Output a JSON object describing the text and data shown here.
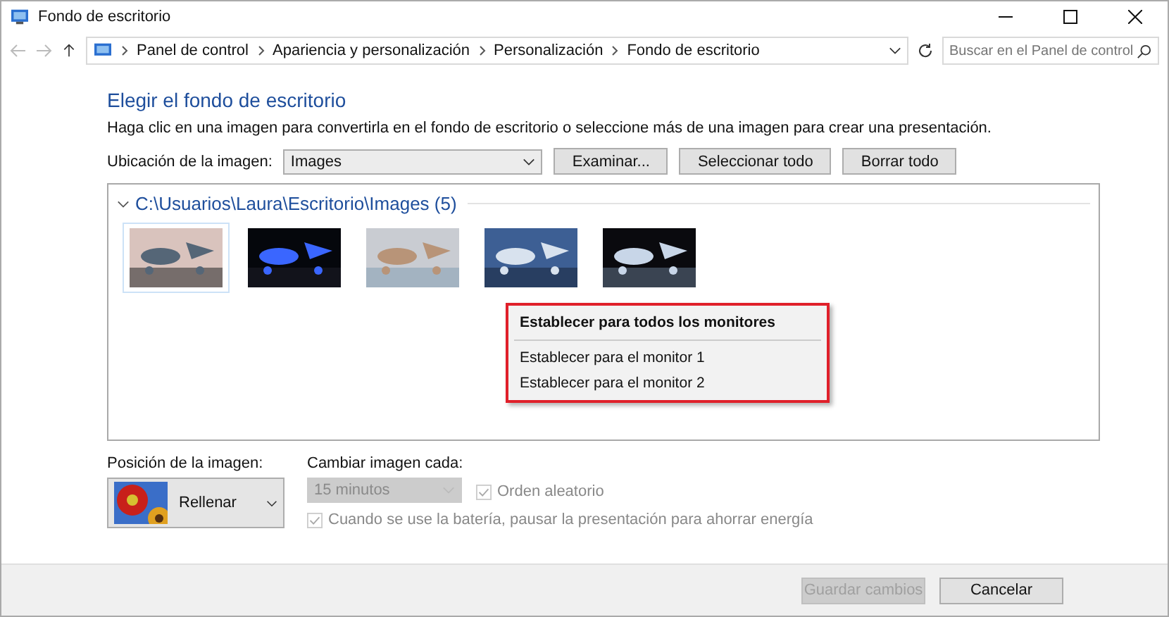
{
  "window": {
    "title": "Fondo de escritorio"
  },
  "address_bar": {
    "crumbs": [
      "Panel de control",
      "Apariencia y personalización",
      "Personalización",
      "Fondo de escritorio"
    ]
  },
  "search": {
    "placeholder": "Buscar en el Panel de control"
  },
  "heading": "Elegir el fondo de escritorio",
  "description": "Haga clic en una imagen para convertirla en el fondo de escritorio o seleccione más de una imagen para crear una presentación.",
  "location": {
    "label": "Ubicación de la imagen:",
    "value": "Images",
    "buttons": [
      "Examinar...",
      "Seleccionar todo",
      "Borrar todo"
    ]
  },
  "folder": {
    "title": "C:\\Usuarios\\Laura\\Escritorio\\Images (5)",
    "expanded": true,
    "images": [
      {
        "kind": "picture",
        "selected": true
      },
      {
        "kind": "picture",
        "selected": false
      },
      {
        "kind": "picture",
        "selected": false
      },
      {
        "kind": "picture",
        "selected": false
      },
      {
        "kind": "picture",
        "selected": false
      }
    ]
  },
  "context_menu": [
    {
      "label": "Establecer para todos los monitores",
      "kind": "default"
    },
    {
      "kind": "separator"
    },
    {
      "label": "Establecer para el monitor 1",
      "kind": "item"
    },
    {
      "label": "Establecer para el monitor 2",
      "kind": "item"
    }
  ],
  "position": {
    "label": "Posición de la imagen:",
    "value": "Rellenar"
  },
  "interval": {
    "label": "Cambiar imagen cada:",
    "value": "15 minutos",
    "disabled": true
  },
  "checkboxes": [
    {
      "label": "Orden aleatorio",
      "checked": true,
      "disabled": true
    },
    {
      "label": "Cuando se use la batería, pausar la presentación para ahorrar energía",
      "checked": true,
      "disabled": true
    }
  ],
  "footer_buttons": [
    {
      "label": "Guardar cambios",
      "disabled": true
    },
    {
      "label": "Cancelar",
      "disabled": false
    }
  ]
}
